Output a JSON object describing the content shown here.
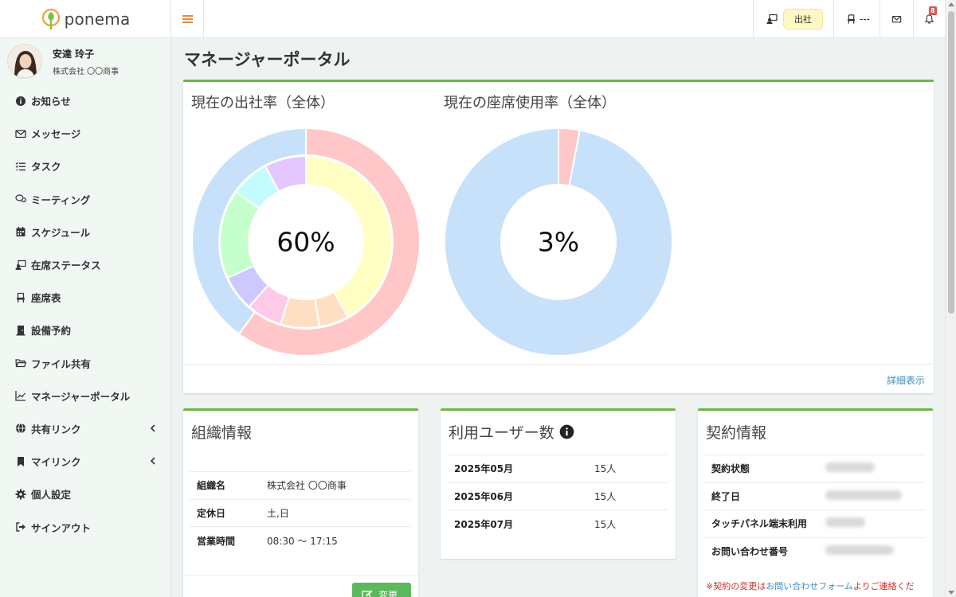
{
  "brand": {
    "name": "ponema"
  },
  "user": {
    "name": "安達 玲子",
    "org": "株式会社 〇〇商事"
  },
  "sidebar": {
    "items": [
      {
        "label": "お知らせ",
        "icon": "info-circle-icon"
      },
      {
        "label": "メッセージ",
        "icon": "envelope-icon"
      },
      {
        "label": "タスク",
        "icon": "list-check-icon"
      },
      {
        "label": "ミーティング",
        "icon": "chat-bubbles-icon"
      },
      {
        "label": "スケジュール",
        "icon": "calendar-icon"
      },
      {
        "label": "在席ステータス",
        "icon": "presence-icon"
      },
      {
        "label": "座席表",
        "icon": "seat-icon"
      },
      {
        "label": "設備予約",
        "icon": "door-icon"
      },
      {
        "label": "ファイル共有",
        "icon": "folder-icon"
      },
      {
        "label": "マネージャーポータル",
        "icon": "line-chart-icon"
      },
      {
        "label": "共有リンク",
        "icon": "globe-icon",
        "expandable": true
      },
      {
        "label": "マイリンク",
        "icon": "bookmark-icon",
        "expandable": true
      },
      {
        "label": "個人設定",
        "icon": "gear-icon"
      },
      {
        "label": "サインアウト",
        "icon": "sign-out-icon"
      }
    ]
  },
  "topbar": {
    "status_label": "出社",
    "seat_label": "---",
    "notification_count": "8"
  },
  "page": {
    "title": "マネージャーポータル"
  },
  "charts_card": {
    "detail_link": "詳細表示",
    "attendance": {
      "title": "現在の出社率（全体）",
      "center_label": "60%"
    },
    "seat_usage": {
      "title": "現在の座席使用率（全体）",
      "center_label": "3%"
    }
  },
  "chart_data": [
    {
      "type": "pie",
      "title": "現在の出社率（全体）",
      "center_label": "60%",
      "rings": [
        {
          "name": "outer",
          "values": [
            60,
            40
          ],
          "colors": [
            "#ffc7c7",
            "#c8e1fb"
          ]
        },
        {
          "name": "inner",
          "values": [
            37.5,
            5,
            6.5,
            6,
            6,
            15,
            6.5,
            7
          ],
          "colors": [
            "#ffffc4",
            "#ffdfc4",
            "#ffdfc4",
            "#ffc9e8",
            "#ccc9ff",
            "#c4ffcc",
            "#c4fbff",
            "#e4c7ff"
          ]
        }
      ]
    },
    {
      "type": "pie",
      "title": "現在の座席使用率（全体）",
      "center_label": "3%",
      "values": [
        3,
        97
      ],
      "colors": [
        "#ffc7c7",
        "#c8e1fb"
      ]
    }
  ],
  "org_info": {
    "title": "組織情報",
    "rows": [
      {
        "label": "組織名",
        "value": "株式会社 〇〇商事"
      },
      {
        "label": "定休日",
        "value": "土,日"
      },
      {
        "label": "営業時間",
        "value": "08:30 〜 17:15"
      }
    ],
    "change_button": "変更"
  },
  "users": {
    "title": "利用ユーザー数",
    "rows": [
      {
        "month": "2025年05月",
        "count": "15人"
      },
      {
        "month": "2025年06月",
        "count": "15人"
      },
      {
        "month": "2025年07月",
        "count": "15人"
      }
    ]
  },
  "contract": {
    "title": "契約情報",
    "rows": [
      {
        "label": "契約状態"
      },
      {
        "label": "終了日"
      },
      {
        "label": "タッチパネル端末利用"
      },
      {
        "label": "お問い合わせ番号"
      }
    ],
    "note_prefix": "※契約の変更は",
    "note_link": "お問い合わせフォーム",
    "note_suffix": "よりご連絡くだ"
  },
  "colors": {
    "accent_green": "#73b34d",
    "link_blue": "#3c8dbc",
    "button_green": "#5cb85c",
    "badge_red": "#d9534f"
  }
}
